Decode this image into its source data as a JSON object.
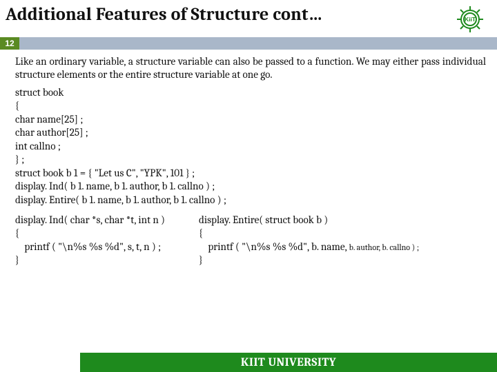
{
  "title": "Additional Features of Structure cont…",
  "page_number": "12",
  "paragraph": "Like an ordinary variable, a structure variable can also be passed to a function. We may either pass individual structure elements or the entire structure variable at one go.",
  "code_block": "struct book\n{\nchar name[25] ;\nchar author[25] ;\nint callno ;\n} ;\nstruct book b 1 = { \"Let us C\", \"YPK\", 101 } ;\ndisplay. Ind( b 1. name, b 1. author, b 1. callno ) ;\ndisplay. Entire( b 1. name, b 1. author, b 1. callno ) ;",
  "func_left": "display. Ind( char *s, char *t, int n )\n{\n    printf ( \"\\n%s %s %d\", s, t, n ) ;\n}",
  "func_right_l1": "display. Entire( struct book b )",
  "func_right_l2": "{",
  "func_right_l3a": "    printf ( \"\\n%s %s %d\", b. name, ",
  "func_right_l3b": "b. author, b. callno ) ;",
  "func_right_l4": "}",
  "footer": "KIIT UNIVERSITY",
  "logo": {
    "text_top": "KiiT",
    "fill": "#1e8a1d"
  }
}
